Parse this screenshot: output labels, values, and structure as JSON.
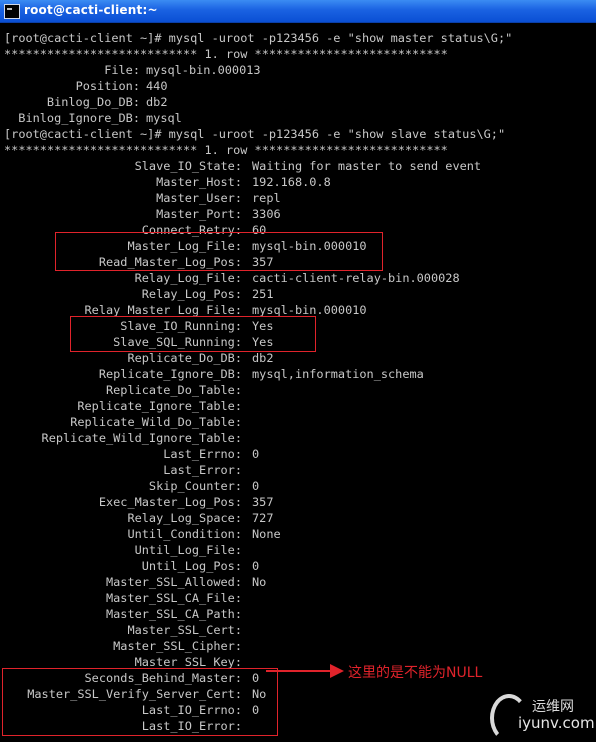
{
  "window": {
    "title": "root@cacti-client:~"
  },
  "commands": [
    "[root@cacti-client ~]# mysql -uroot -p123456 -e \"show master status\\G;\"",
    "[root@cacti-client ~]# mysql -uroot -p123456 -e \"show slave status\\G;\""
  ],
  "separators": [
    "*************************** 1. row ***************************",
    "*************************** 1. row ***************************"
  ],
  "master_status": [
    {
      "key": "File:",
      "value": "mysql-bin.000013"
    },
    {
      "key": "Position:",
      "value": "440"
    },
    {
      "key": "Binlog_Do_DB:",
      "value": "db2"
    },
    {
      "key": "Binlog_Ignore_DB:",
      "value": "mysql"
    }
  ],
  "slave_status": [
    {
      "key": "Slave_IO_State:",
      "value": "Waiting for master to send event"
    },
    {
      "key": "Master_Host:",
      "value": "192.168.0.8"
    },
    {
      "key": "Master_User:",
      "value": "repl"
    },
    {
      "key": "Master_Port:",
      "value": "3306"
    },
    {
      "key": "Connect_Retry:",
      "value": "60"
    },
    {
      "key": "Master_Log_File:",
      "value": "mysql-bin.000010"
    },
    {
      "key": "Read_Master_Log_Pos:",
      "value": "357"
    },
    {
      "key": "Relay_Log_File:",
      "value": "cacti-client-relay-bin.000028"
    },
    {
      "key": "Relay_Log_Pos:",
      "value": "251"
    },
    {
      "key": "Relay_Master_Log_File:",
      "value": "mysql-bin.000010"
    },
    {
      "key": "Slave_IO_Running:",
      "value": "Yes"
    },
    {
      "key": "Slave_SQL_Running:",
      "value": "Yes"
    },
    {
      "key": "Replicate_Do_DB:",
      "value": "db2"
    },
    {
      "key": "Replicate_Ignore_DB:",
      "value": "mysql,information_schema"
    },
    {
      "key": "Replicate_Do_Table:",
      "value": ""
    },
    {
      "key": "Replicate_Ignore_Table:",
      "value": ""
    },
    {
      "key": "Replicate_Wild_Do_Table:",
      "value": ""
    },
    {
      "key": "Replicate_Wild_Ignore_Table:",
      "value": ""
    },
    {
      "key": "Last_Errno:",
      "value": "0"
    },
    {
      "key": "Last_Error:",
      "value": ""
    },
    {
      "key": "Skip_Counter:",
      "value": "0"
    },
    {
      "key": "Exec_Master_Log_Pos:",
      "value": "357"
    },
    {
      "key": "Relay_Log_Space:",
      "value": "727"
    },
    {
      "key": "Until_Condition:",
      "value": "None"
    },
    {
      "key": "Until_Log_File:",
      "value": ""
    },
    {
      "key": "Until_Log_Pos:",
      "value": "0"
    },
    {
      "key": "Master_SSL_Allowed:",
      "value": "No"
    },
    {
      "key": "Master_SSL_CA_File:",
      "value": ""
    },
    {
      "key": "Master_SSL_CA_Path:",
      "value": ""
    },
    {
      "key": "Master_SSL_Cert:",
      "value": ""
    },
    {
      "key": "Master_SSL_Cipher:",
      "value": ""
    },
    {
      "key": "Master_SSL_Key:",
      "value": ""
    },
    {
      "key": "Seconds_Behind_Master:",
      "value": "0"
    },
    {
      "key": "Master_SSL_Verify_Server_Cert:",
      "value": "No"
    },
    {
      "key": "Last_IO_Errno:",
      "value": "0"
    },
    {
      "key": "Last_IO_Error:",
      "value": ""
    }
  ],
  "annotation": {
    "note": "这里的是不能为NULL",
    "color": "#e0232b"
  },
  "watermark": {
    "brand": "运维网",
    "url": "iyunv.com"
  },
  "colors": {
    "terminal_bg": "#000000",
    "terminal_fg": "#c8c8c8",
    "titlebar": "#1a62e2",
    "highlight": "#e0232b"
  }
}
